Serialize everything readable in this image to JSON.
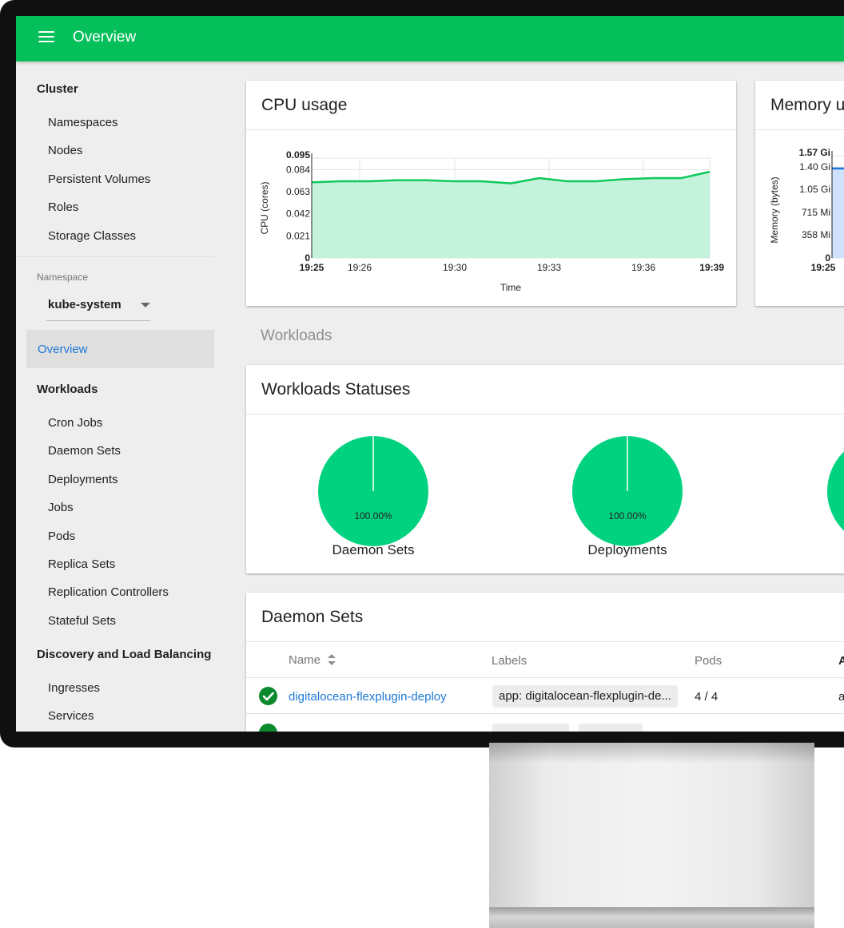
{
  "topbar": {
    "title": "Overview"
  },
  "sidebar": {
    "cluster_header": "Cluster",
    "cluster_items": [
      "Namespaces",
      "Nodes",
      "Persistent Volumes",
      "Roles",
      "Storage Classes"
    ],
    "namespace_caption": "Namespace",
    "namespace_value": "kube-system",
    "overview": "Overview",
    "workloads_header": "Workloads",
    "workload_items": [
      "Cron Jobs",
      "Daemon Sets",
      "Deployments",
      "Jobs",
      "Pods",
      "Replica Sets",
      "Replication Controllers",
      "Stateful Sets"
    ],
    "discovery_header": "Discovery and Load Balancing",
    "discovery_items": [
      "Ingresses",
      "Services"
    ]
  },
  "cpu_card": {
    "title": "CPU usage"
  },
  "memory_card": {
    "title": "Memory u"
  },
  "workloads_section": "Workloads",
  "statuses_card": {
    "title": "Workloads Statuses"
  },
  "daemon_sets_card": {
    "title": "Daemon Sets",
    "columns": [
      "Name",
      "Labels",
      "Pods",
      "A"
    ],
    "rows": [
      {
        "name": "digitalocean-flexplugin-deploy",
        "label": "app: digitalocean-flexplugin-de...",
        "pods": "4 / 4",
        "age": "a"
      }
    ]
  },
  "chart_data": [
    {
      "type": "area",
      "title": "CPU usage",
      "xlabel": "Time",
      "ylabel": "CPU (cores)",
      "ylim": [
        0,
        0.095
      ],
      "yticks": [
        "0",
        "0.021",
        "0.042",
        "0.063",
        "0.084",
        "0.095"
      ],
      "xticks": [
        "19:25",
        "19:26",
        "19:30",
        "19:33",
        "19:36",
        "19:39"
      ],
      "series": [
        {
          "values": [
            0.072,
            0.073,
            0.073,
            0.074,
            0.074,
            0.073,
            0.073,
            0.071,
            0.076,
            0.073,
            0.073,
            0.075,
            0.076,
            0.076,
            0.082
          ]
        }
      ],
      "color": "#0fc95a",
      "fill": "#c4f2da",
      "grid": true
    },
    {
      "type": "area",
      "title": "Memory u",
      "ylabel": "Memory (bytes)",
      "yticks": [
        "0",
        "358 Mi",
        "715 Mi",
        "1.05 Gi",
        "1.40 Gi",
        "1.57 Gi"
      ],
      "xticks": [
        "19:25"
      ],
      "series": [
        {
          "values": [
            1.4,
            1.4
          ]
        }
      ],
      "color": "#1e78d6",
      "fill": "#cfe1fb"
    },
    {
      "type": "pie",
      "categories": [
        "Daemon Sets",
        "Deployments"
      ],
      "slices": [
        {
          "label": "Daemon Sets",
          "percent": "100.00%",
          "value": 100
        },
        {
          "label": "Deployments",
          "percent": "100.00%",
          "value": 100
        }
      ],
      "color": "#00d27f"
    }
  ]
}
